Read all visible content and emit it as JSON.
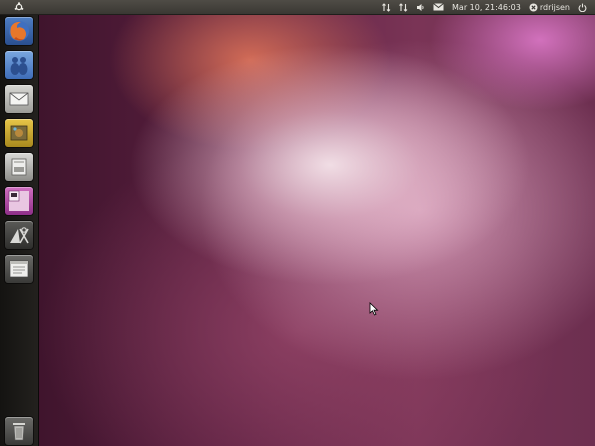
{
  "top_panel": {
    "clock": "Mar 10, 21:46:03",
    "username": "rdrijsen"
  },
  "launcher": {
    "items": [
      {
        "name": "firefox-icon"
      },
      {
        "name": "empathy-icon"
      },
      {
        "name": "evolution-mail-icon"
      },
      {
        "name": "shotwell-icon"
      },
      {
        "name": "disk-utility-icon"
      },
      {
        "name": "workspace-switcher-icon"
      },
      {
        "name": "system-settings-icon"
      },
      {
        "name": "file-manager-icon"
      }
    ],
    "trash": {
      "name": "trash-icon"
    }
  },
  "colors": {
    "panel": "#3a3833",
    "launcher": "#1c1b19",
    "wallpaper_accent": "#c94f86"
  }
}
